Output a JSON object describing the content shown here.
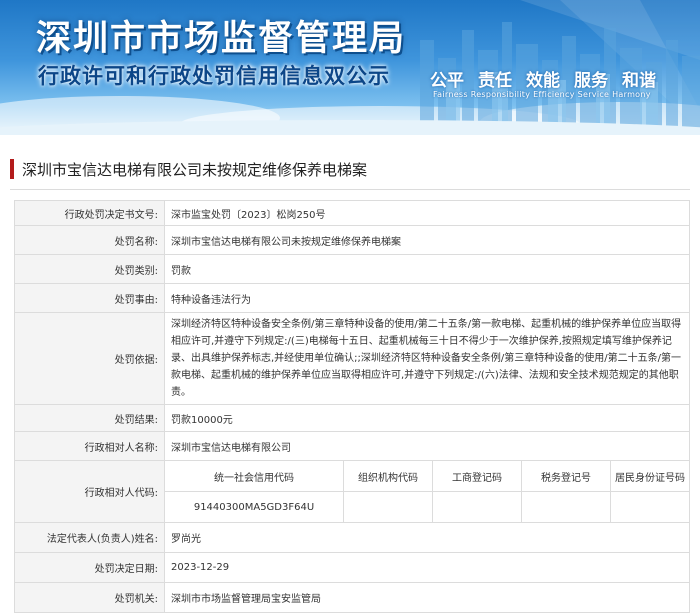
{
  "banner": {
    "title": "深圳市市场监督管理局",
    "subtitle": "行政许可和行政处罚信用信息双公示",
    "slogans": [
      "公平",
      "责任",
      "效能",
      "服务",
      "和谐"
    ],
    "slogan_en": "Fairness  Responsibility  Efficiency  Service  Harmony"
  },
  "case": {
    "title": "深圳市宝信达电梯有限公司未按规定维修保养电梯案"
  },
  "rows": {
    "doc_no": {
      "label": "行政处罚决定书文号:",
      "value": "深市监宝处罚〔2023〕松岗250号"
    },
    "name": {
      "label": "处罚名称:",
      "value": "深圳市宝信达电梯有限公司未按规定维修保养电梯案"
    },
    "category": {
      "label": "处罚类别:",
      "value": "罚款"
    },
    "reason": {
      "label": "处罚事由:",
      "value": "特种设备违法行为"
    },
    "basis": {
      "label": "处罚依据:",
      "value": "深圳经济特区特种设备安全条例/第三章特种设备的使用/第二十五条/第一款电梯、起重机械的维护保养单位应当取得相应许可,并遵守下列规定:/(三)电梯每十五日、起重机械每三十日不得少于一次维护保养,按照规定填写维护保养记录、出具维护保养标志,并经使用单位确认;;深圳经济特区特种设备安全条例/第三章特种设备的使用/第二十五条/第一款电梯、起重机械的维护保养单位应当取得相应许可,并遵守下列规定:/(六)法律、法规和安全技术规范规定的其他职责。"
    },
    "result": {
      "label": "处罚结果:",
      "value": "罚款10000元"
    },
    "party": {
      "label": "行政相对人名称:",
      "value": "深圳市宝信达电梯有限公司"
    },
    "codes": {
      "label": "行政相对人代码:",
      "headers": [
        "统一社会信用代码",
        "组织机构代码",
        "工商登记码",
        "税务登记号",
        "居民身份证号码"
      ],
      "values": [
        "91440300MA5GD3F64U",
        "",
        "",
        "",
        ""
      ]
    },
    "legal_rep": {
      "label": "法定代表人(负责人)姓名:",
      "value": "罗尚光"
    },
    "date": {
      "label": "处罚决定日期:",
      "value": "2023-12-29"
    },
    "authority": {
      "label": "处罚机关:",
      "value": "深圳市市场监督管理局宝安监管局"
    }
  },
  "colors": {
    "accent": "#b31b1b",
    "banner_blue": "#1f77c6",
    "label_bg": "#f4f4f4",
    "border": "#dcdcdc"
  }
}
